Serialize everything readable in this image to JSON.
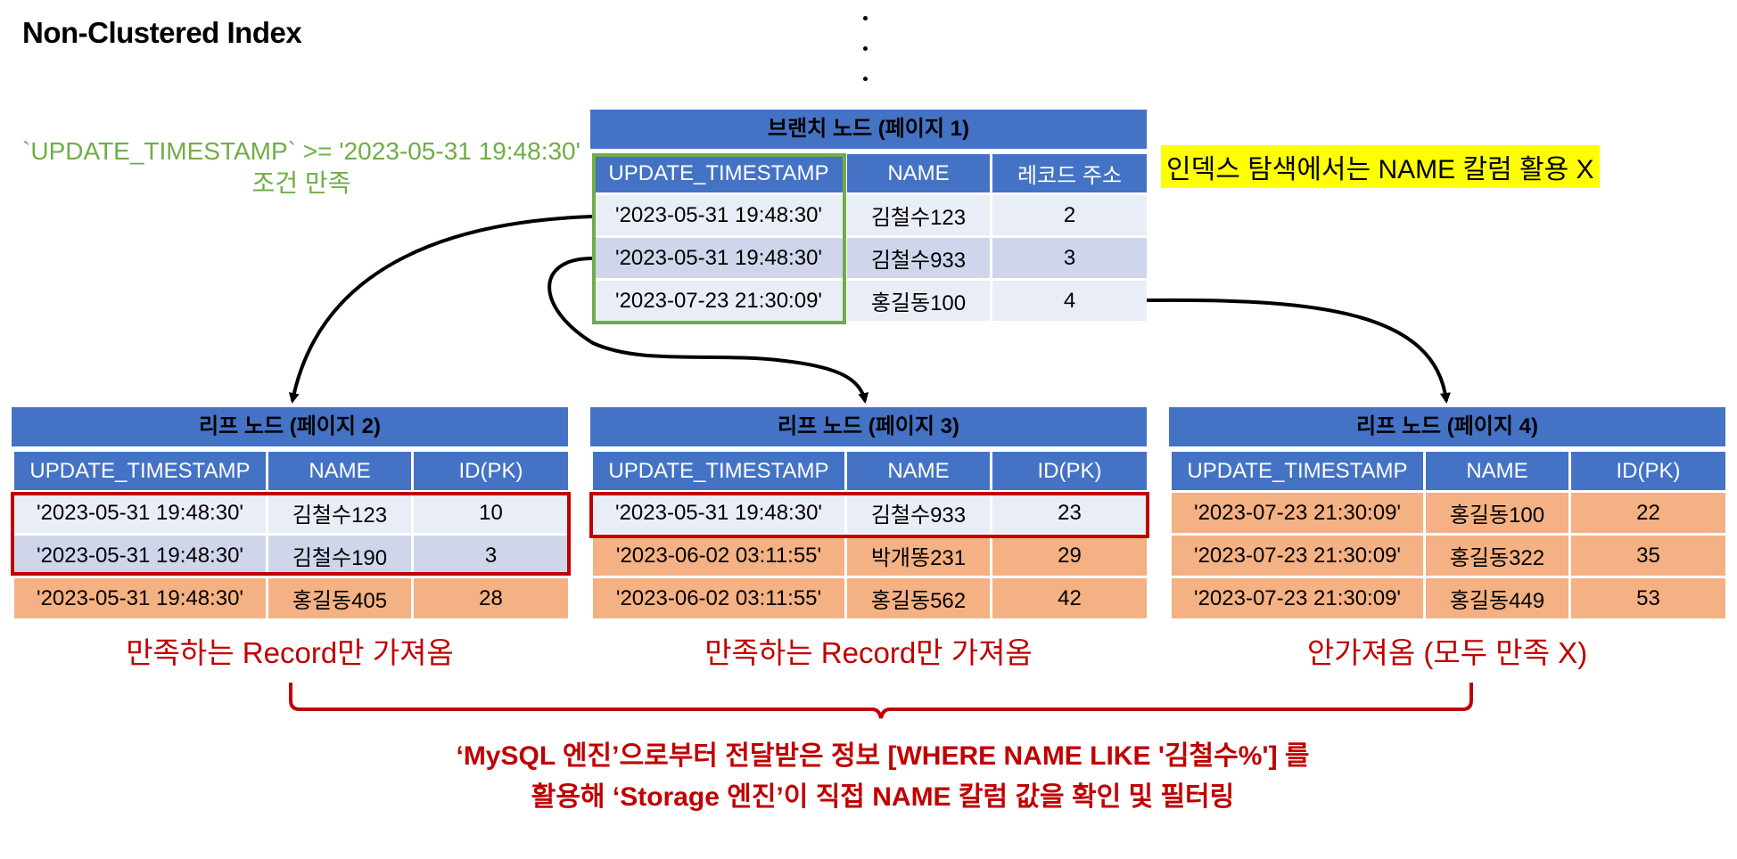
{
  "title": "Non-Clustered Index",
  "condition": {
    "line1": "`UPDATE_TIMESTAMP` >= '2023-05-31 19:48:30'",
    "line2": "조건 만족"
  },
  "note": "인덱스 탐색에서는 NAME 칼럼 활용 X",
  "branch": {
    "title": "브랜치 노드 (페이지 1)",
    "headers": [
      "UPDATE_TIMESTAMP",
      "NAME",
      "레코드 주소"
    ],
    "rows": [
      [
        "'2023-05-31 19:48:30'",
        "김철수123",
        "2"
      ],
      [
        "'2023-05-31 19:48:30'",
        "김철수933",
        "3"
      ],
      [
        "'2023-07-23 21:30:09'",
        "홍길동100",
        "4"
      ]
    ]
  },
  "leaves": [
    {
      "title": "리프 노드 (페이지 2)",
      "headers": [
        "UPDATE_TIMESTAMP",
        "NAME",
        "ID(PK)"
      ],
      "rows": [
        [
          "'2023-05-31 19:48:30'",
          "김철수123",
          "10"
        ],
        [
          "'2023-05-31 19:48:30'",
          "김철수190",
          "3"
        ],
        [
          "'2023-05-31 19:48:30'",
          "홍길동405",
          "28"
        ]
      ],
      "caption": "만족하는 Record만 가져옴"
    },
    {
      "title": "리프 노드 (페이지 3)",
      "headers": [
        "UPDATE_TIMESTAMP",
        "NAME",
        "ID(PK)"
      ],
      "rows": [
        [
          "'2023-05-31 19:48:30'",
          "김철수933",
          "23"
        ],
        [
          "'2023-06-02 03:11:55'",
          "박개똥231",
          "29"
        ],
        [
          "'2023-06-02 03:11:55'",
          "홍길동562",
          "42"
        ]
      ],
      "caption": "만족하는 Record만 가져옴"
    },
    {
      "title": "리프 노드 (페이지 4)",
      "headers": [
        "UPDATE_TIMESTAMP",
        "NAME",
        "ID(PK)"
      ],
      "rows": [
        [
          "'2023-07-23 21:30:09'",
          "홍길동100",
          "22"
        ],
        [
          "'2023-07-23 21:30:09'",
          "홍길동322",
          "35"
        ],
        [
          "'2023-07-23 21:30:09'",
          "홍길동449",
          "53"
        ]
      ],
      "caption": "안가져옴 (모두 만족 X)"
    }
  ],
  "footer": {
    "line1": "‘MySQL 엔진’으로부터 전달받은 정보 [WHERE NAME LIKE '김철수%']  를",
    "line2": "활용해 ‘Storage 엔진’이 직접 NAME 칼럼 값을 확인 및 필터링"
  },
  "colors": {
    "header_blue": "#4472c4",
    "row_light": "#e9edf5",
    "row_mid": "#cfd6eb",
    "row_orange": "#f4b183",
    "green": "#70ad47",
    "red": "#c00000",
    "highlight": "#ffff00"
  }
}
